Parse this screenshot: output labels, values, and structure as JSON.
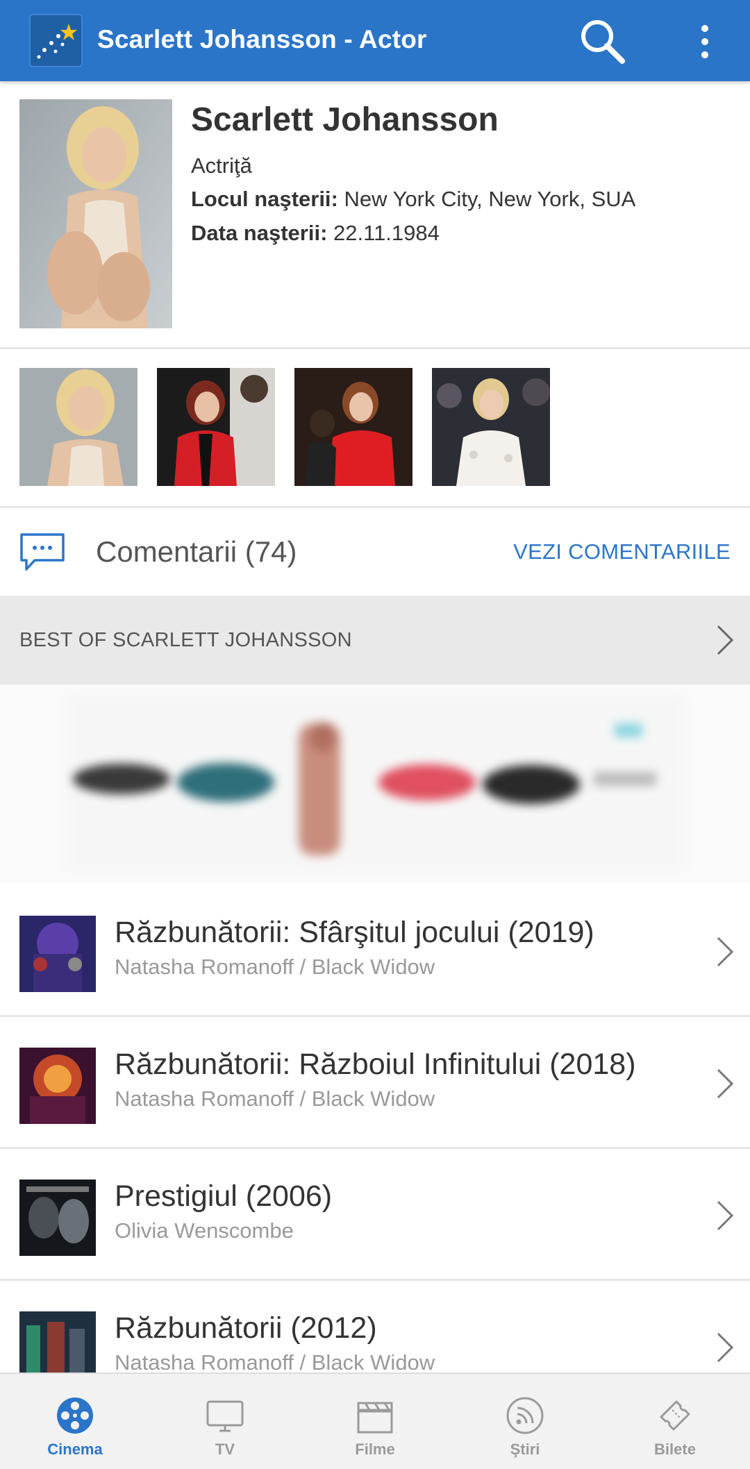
{
  "app": {
    "title": "Scarlett Johansson - Actor",
    "accent": "#2b75c8"
  },
  "profile": {
    "name": "Scarlett Johansson",
    "role": "Actriţă",
    "birthplace_label": "Locul naşterii:",
    "birthplace": "New York City, New York, SUA",
    "birthdate_label": "Data naşterii:",
    "birthdate": "22.11.1984"
  },
  "gallery": {
    "count": 4
  },
  "comments": {
    "label": "Comentarii (74)",
    "link": "VEZI COMENTARIILE"
  },
  "bestof": {
    "label": "BEST OF SCARLETT JOHANSSON"
  },
  "films": [
    {
      "title": "Răzbunătorii: Sfârşitul jocului (2019)",
      "role": "Natasha Romanoff / Black Widow"
    },
    {
      "title": "Răzbunătorii: Războiul Infinitului (2018)",
      "role": "Natasha Romanoff / Black Widow"
    },
    {
      "title": "Prestigiul (2006)",
      "role": "Olivia Wenscombe"
    },
    {
      "title": "Răzbunătorii (2012)",
      "role": "Natasha Romanoff / Black Widow"
    }
  ],
  "nav": [
    {
      "label": "Cinema",
      "icon": "film-reel-icon",
      "active": true
    },
    {
      "label": "TV",
      "icon": "tv-icon",
      "active": false
    },
    {
      "label": "Filme",
      "icon": "clapperboard-icon",
      "active": false
    },
    {
      "label": "Ştiri",
      "icon": "rss-icon",
      "active": false
    },
    {
      "label": "Bilete",
      "icon": "ticket-icon",
      "active": false
    }
  ]
}
